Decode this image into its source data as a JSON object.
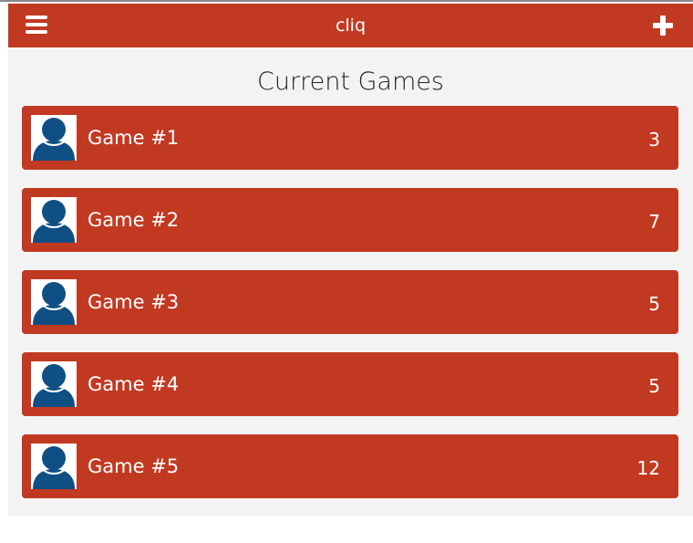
{
  "header": {
    "title": "cliq",
    "menu_icon": "hamburger-menu-icon",
    "add_icon": "plus-icon"
  },
  "main": {
    "title": "Current Games"
  },
  "games": [
    {
      "name": "Game #1",
      "count": "3"
    },
    {
      "name": "Game #2",
      "count": "7"
    },
    {
      "name": "Game #3",
      "count": "5"
    },
    {
      "name": "Game #4",
      "count": "5"
    },
    {
      "name": "Game #5",
      "count": "12"
    }
  ],
  "colors": {
    "accent": "#c23921",
    "background": "#f3f3f3",
    "avatar": "#0f4f83"
  }
}
